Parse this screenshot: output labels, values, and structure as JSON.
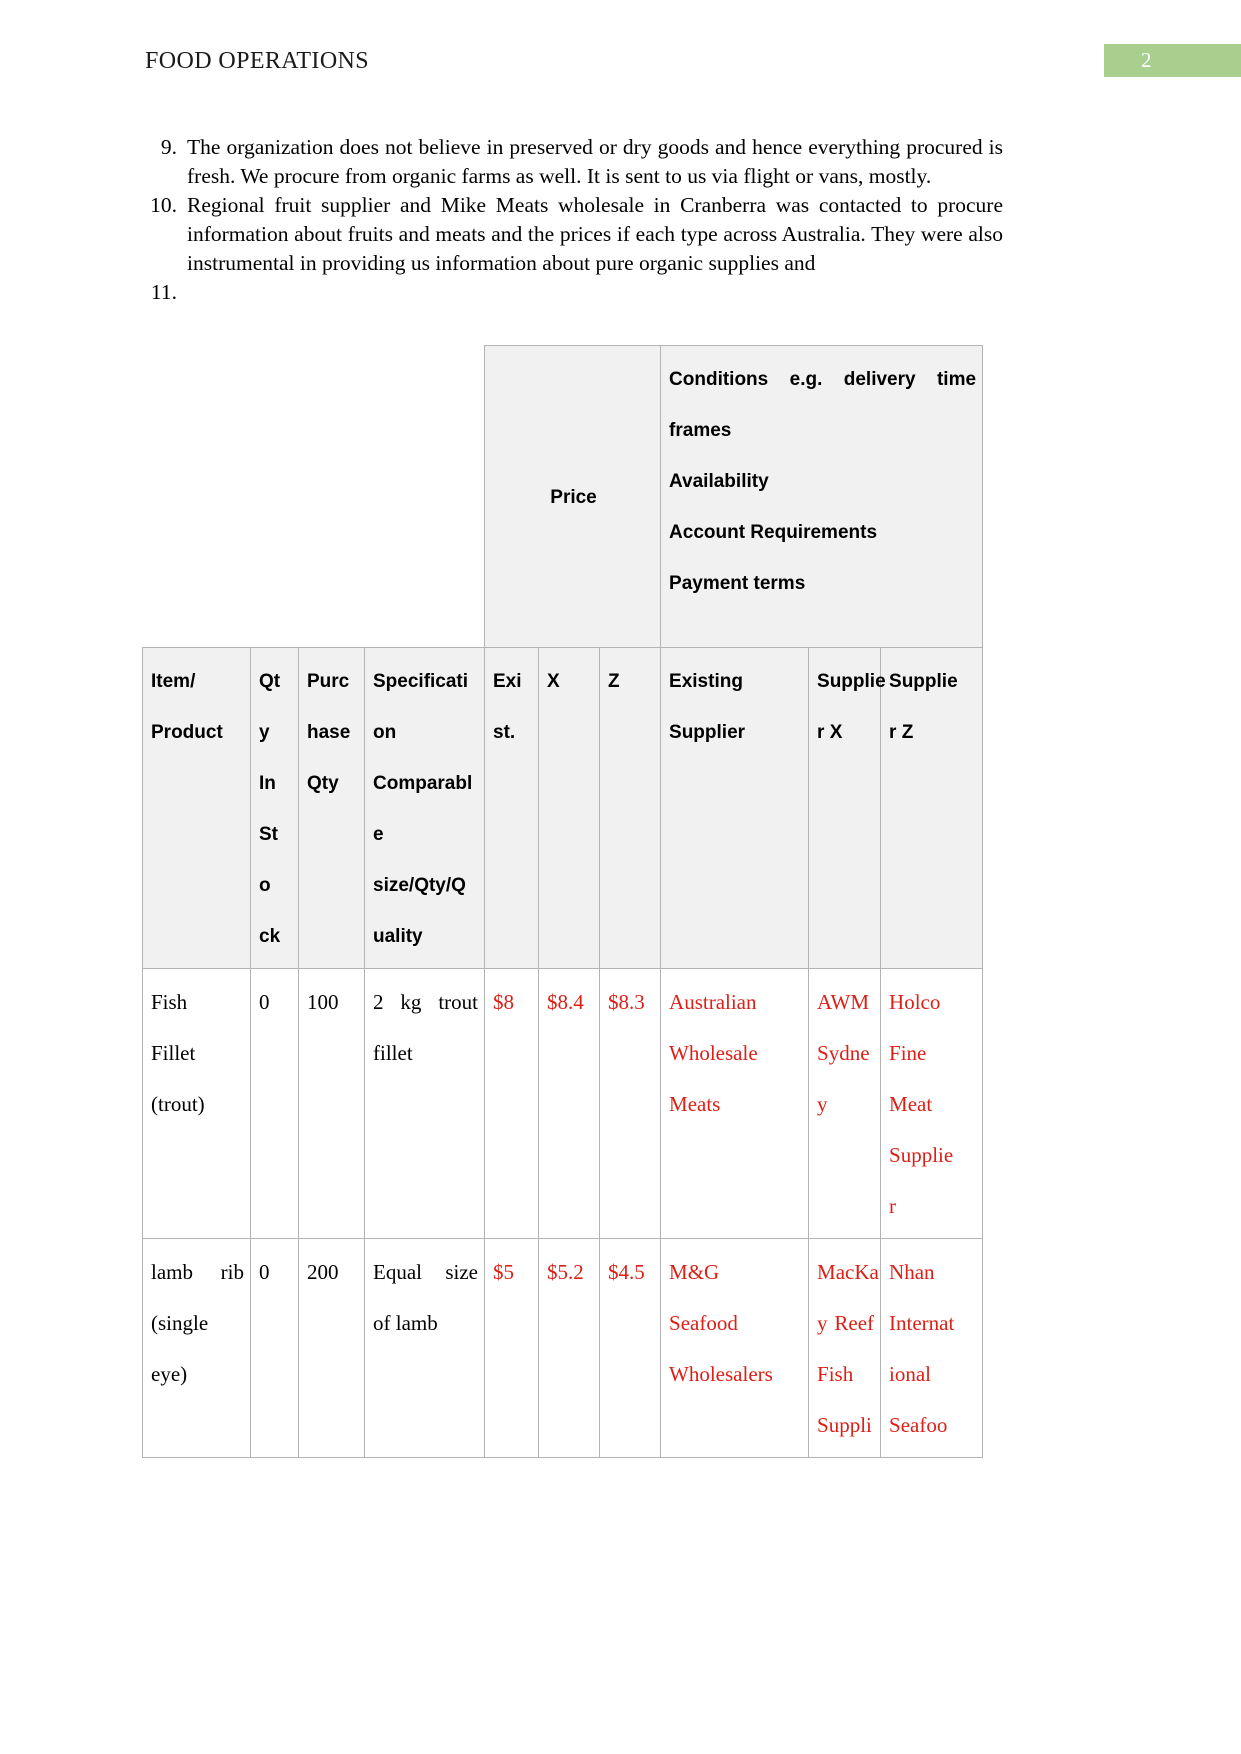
{
  "header": {
    "title": "FOOD OPERATIONS",
    "page_number": "2",
    "badge_color": "#a8cf8e"
  },
  "list": [
    {
      "number": "9.",
      "text": "The organization does not believe in preserved or dry goods and hence everything procured is fresh. We procure from organic farms as well. It is sent to us via flight or vans, mostly."
    },
    {
      "number": "10.",
      "text": "Regional fruit supplier and Mike Meats wholesale in Cranberra was contacted to procure information about fruits and meats and the prices if each type across Australia. They were also instrumental in providing us information about pure organic supplies and"
    },
    {
      "number": "11.",
      "text": ""
    }
  ],
  "table": {
    "group_headers": {
      "price": "Price",
      "conditions_line1": "Conditions e.g. delivery time",
      "conditions_line2": "frames",
      "conditions_line3": "Availability",
      "conditions_line4": "Account Requirements",
      "conditions_line5": "Payment terms"
    },
    "columns": [
      {
        "key": "item",
        "lines": [
          "Item/",
          "Product"
        ]
      },
      {
        "key": "qty_in_stock",
        "lines": [
          "Qt",
          "y",
          "In",
          "St",
          "o",
          "ck"
        ]
      },
      {
        "key": "purchase_qty",
        "lines": [
          "Purc",
          "hase",
          "Qty"
        ]
      },
      {
        "key": "specification",
        "lines": [
          "Specificati",
          "on",
          "Comparabl",
          "e",
          "size/Qty/Q",
          "uality"
        ]
      },
      {
        "key": "price_existing",
        "lines": [
          "Exi",
          "st."
        ]
      },
      {
        "key": "price_x",
        "lines": [
          "X"
        ]
      },
      {
        "key": "price_z",
        "lines": [
          "Z"
        ]
      },
      {
        "key": "existing_supplier",
        "lines": [
          "Existing",
          "Supplier"
        ]
      },
      {
        "key": "supplier_x",
        "lines": [
          "Supplie",
          "r X"
        ]
      },
      {
        "key": "supplier_z",
        "lines": [
          "Supplie",
          "r Z"
        ]
      }
    ],
    "rows": [
      {
        "item": [
          "Fish",
          "Fillet",
          "(trout)"
        ],
        "qty_in_stock": [
          "0"
        ],
        "purchase_qty": [
          "100"
        ],
        "specification": [
          "2 kg trout",
          "fillet"
        ],
        "price_existing": [
          "$8"
        ],
        "price_x": [
          "$8.4"
        ],
        "price_z": [
          "$8.3"
        ],
        "existing_supplier": [
          "Australian",
          "Wholesale",
          "Meats"
        ],
        "supplier_x": [
          "AWM",
          "Sydne",
          "y"
        ],
        "supplier_z": [
          "Holco",
          "Fine",
          "Meat",
          "Supplie",
          "r"
        ]
      },
      {
        "item": [
          "lamb rib",
          "(single",
          "eye)"
        ],
        "qty_in_stock": [
          "0"
        ],
        "purchase_qty": [
          "200"
        ],
        "specification": [
          "Equal size",
          "of lamb"
        ],
        "price_existing": [
          "$5"
        ],
        "price_x": [
          "$5.2"
        ],
        "price_z": [
          "$4.5"
        ],
        "existing_supplier": [
          "M&G",
          "Seafood",
          "Wholesalers"
        ],
        "supplier_x": [
          "MacKa",
          "y Reef",
          "Fish",
          "Suppli"
        ],
        "supplier_z": [
          "Nhan",
          "Internat",
          "ional",
          "Seafoo"
        ]
      }
    ]
  }
}
